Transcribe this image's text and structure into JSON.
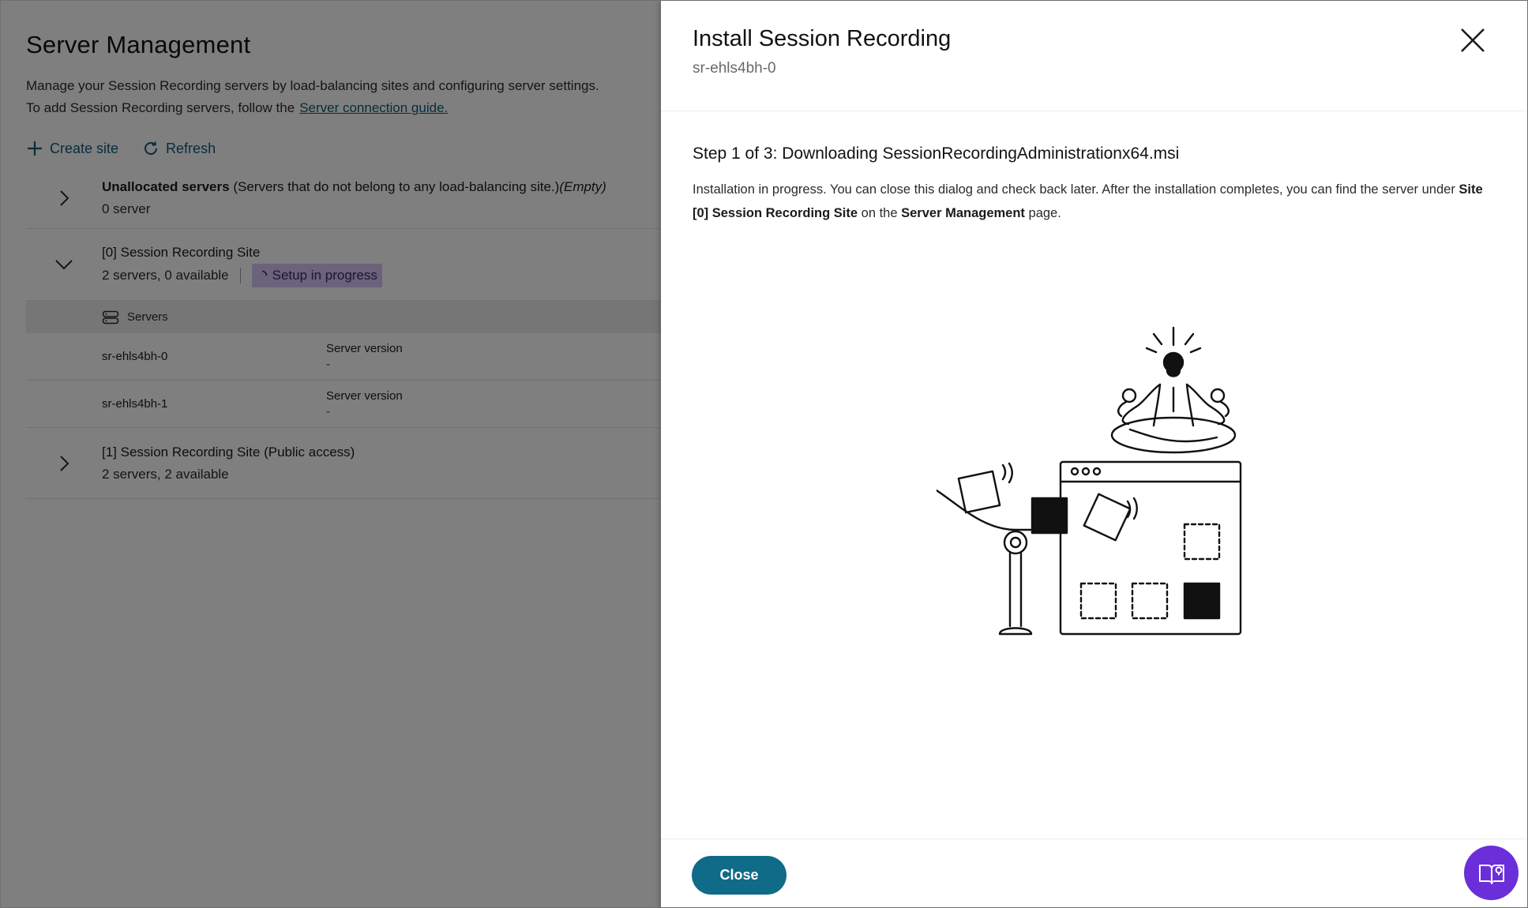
{
  "background": {
    "title": "Server Management",
    "desc_line1": "Manage your Session Recording servers by load-balancing sites and configuring server settings.",
    "desc_line2": "To add Session Recording servers, follow the",
    "guide_link": "Server connection guide.",
    "toolbar": {
      "create_site": "Create site",
      "refresh": "Refresh"
    },
    "unallocated": {
      "name": "Unallocated servers",
      "note": "(Servers that do not belong to any load-balancing site.)",
      "empty": "(Empty)",
      "count": "0 server"
    },
    "site0": {
      "name": "[0] Session Recording Site",
      "count": "2 servers, 0 available",
      "badge": "Setup in progress",
      "servers_header": "Servers",
      "servers": [
        {
          "name": "sr-ehls4bh-0",
          "version_label": "Server version",
          "version_value": "-"
        },
        {
          "name": "sr-ehls4bh-1",
          "version_label": "Server version",
          "version_value": "-"
        }
      ]
    },
    "site1": {
      "name": "[1] Session Recording Site",
      "access": "(Public access)",
      "count": "2 servers, 2 available"
    }
  },
  "dialog": {
    "title": "Install Session Recording",
    "subtitle": "sr-ehls4bh-0",
    "step_title": "Step 1 of 3: Downloading SessionRecordingAdministrationx64.msi",
    "desc_part1": "Installation in progress. You can close this dialog and check back later. After the installation completes, you can find the server under",
    "desc_bold1": "Site [0] Session Recording Site",
    "desc_part2": "on the",
    "desc_bold2": "Server Management",
    "desc_part3": "page.",
    "close_button": "Close"
  },
  "colors": {
    "accent": "#0f6b87",
    "link": "#0f5a79",
    "badge_bg": "#d6c6f6",
    "help_fab": "#6b2fd9"
  },
  "icons": [
    "plus-icon",
    "refresh-icon",
    "chevron-right-icon",
    "chevron-down-icon",
    "spinner-icon",
    "servers-icon",
    "close-icon",
    "help-book-icon"
  ]
}
